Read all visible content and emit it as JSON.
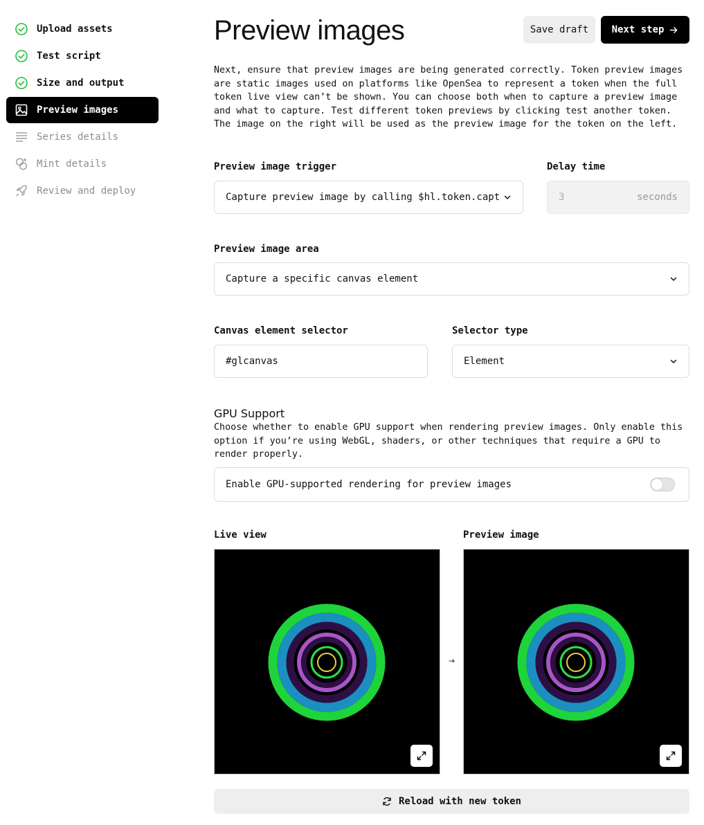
{
  "sidebar": {
    "items": [
      {
        "label": "Upload assets",
        "state": "done",
        "icon": "check-circle-icon"
      },
      {
        "label": "Test script",
        "state": "done",
        "icon": "check-circle-icon"
      },
      {
        "label": "Size and output",
        "state": "done",
        "icon": "check-circle-icon"
      },
      {
        "label": "Preview images",
        "state": "active",
        "icon": "image-icon"
      },
      {
        "label": "Series details",
        "state": "todo",
        "icon": "lines-icon"
      },
      {
        "label": "Mint details",
        "state": "todo",
        "icon": "mint-icon"
      },
      {
        "label": "Review and deploy",
        "state": "todo",
        "icon": "rocket-icon"
      }
    ]
  },
  "header": {
    "title": "Preview images",
    "save_label": "Save draft",
    "next_label": "Next step"
  },
  "intro": "Next, ensure that preview images are being generated correctly. Token preview images are static images used on platforms like OpenSea to represent a token when the full token live view can’t be shown. You can choose both when to capture a preview image and what to capture. Test different token previews by clicking test another token. The image on the right will be used as the preview image for the token on the left.",
  "form": {
    "trigger": {
      "label": "Preview image trigger",
      "value": "Capture preview image by calling $hl.token.capturePreview()"
    },
    "delay": {
      "label": "Delay time",
      "value": "3",
      "unit": "seconds"
    },
    "area": {
      "label": "Preview image area",
      "value": "Capture a specific canvas element"
    },
    "selector": {
      "label": "Canvas element selector",
      "value": "#glcanvas"
    },
    "selector_type": {
      "label": "Selector type",
      "value": "Element"
    }
  },
  "gpu": {
    "title": "GPU Support",
    "description": "Choose whether to enable GPU support when rendering preview images. Only enable this option if you’re using WebGL, shaders, or other techniques that require a GPU to render properly.",
    "toggle_label": "Enable GPU-supported rendering for preview images",
    "enabled": false
  },
  "views": {
    "live_label": "Live view",
    "preview_label": "Preview image"
  },
  "reload_label": "Reload with new token",
  "colors": {
    "accent_done": "#1fbf3a",
    "ring_green": "#1ed43a",
    "ring_blue": "#1b8fc0",
    "ring_dark_purple": "#2e0f45",
    "ring_purple": "#a855c8",
    "ring_bright_green": "#2be04a",
    "ring_yellow": "#e8d23a"
  }
}
